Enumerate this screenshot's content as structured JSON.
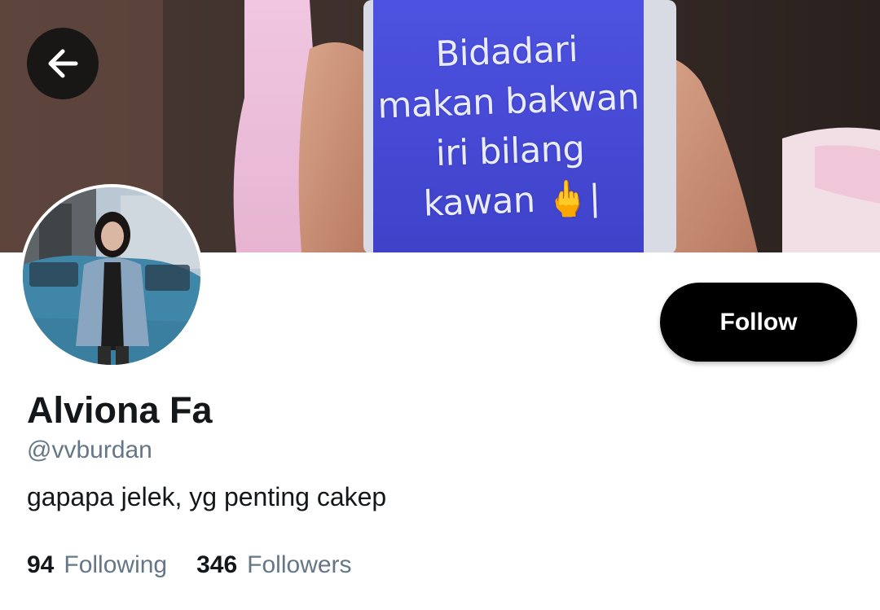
{
  "header": {
    "banner_text_lines": [
      "Bidadari",
      "makan bakwan",
      "iri bilang",
      "kawan 🖕|"
    ],
    "back_icon": "arrow-left-icon"
  },
  "profile": {
    "avatar_icon": "profile-photo",
    "display_name": "Alviona Fa",
    "handle": "@vvburdan",
    "bio": "gapapa jelek, yg penting cakep",
    "follow_label": "Follow"
  },
  "stats": {
    "following_count": "94",
    "following_label": "Following",
    "followers_count": "346",
    "followers_label": "Followers"
  },
  "colors": {
    "follow_button_bg": "#000000",
    "follow_button_text": "#ffffff",
    "primary_text": "#14171a",
    "secondary_text": "#657786",
    "banner_screen": "#4a4fd8"
  }
}
